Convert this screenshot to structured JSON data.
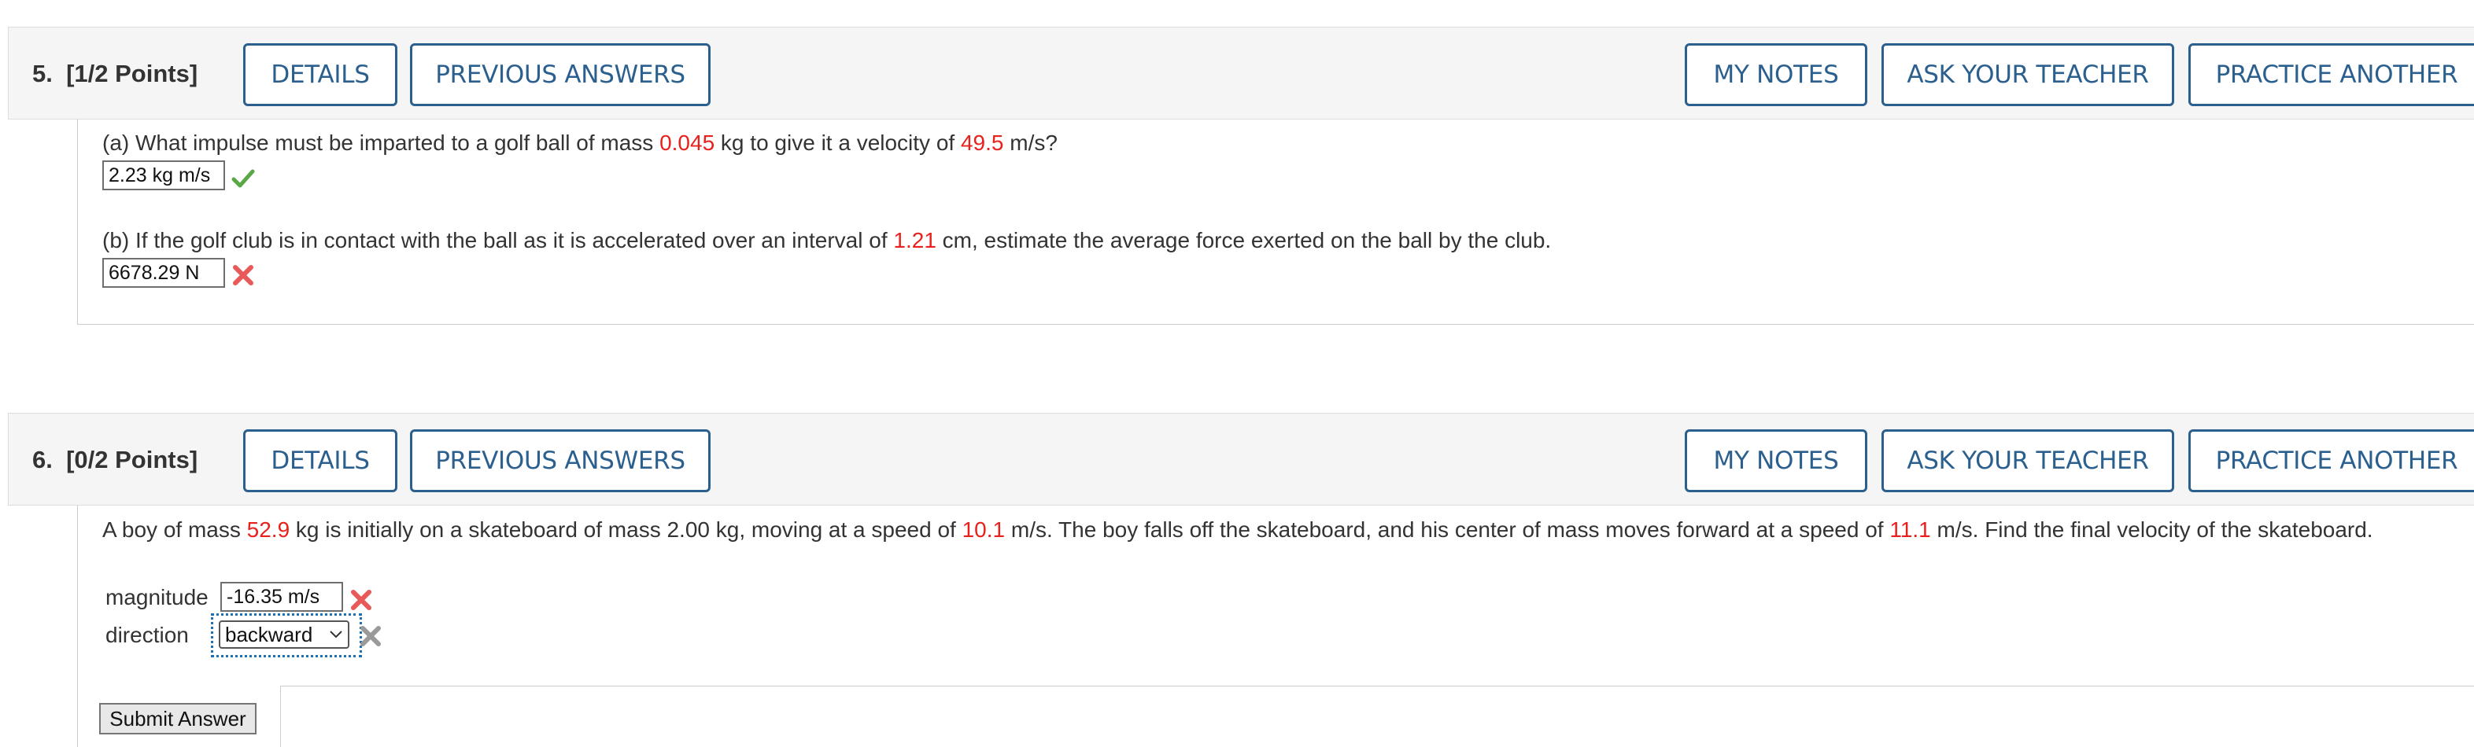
{
  "q5": {
    "number": "5.",
    "points": "[1/2 Points]",
    "buttons": {
      "details": "DETAILS",
      "previous_answers": "PREVIOUS ANSWERS",
      "my_notes": "MY NOTES",
      "ask_teacher": "ASK YOUR TEACHER",
      "practice": "PRACTICE ANOTHER"
    },
    "part_a": {
      "t1": "(a) What impulse must be imparted to a golf ball of mass ",
      "mass": "0.045",
      "t2": " kg to give it a velocity of ",
      "velocity": "49.5",
      "t3": " m/s?",
      "answer": "2.23 kg m/s",
      "status": "correct"
    },
    "part_b": {
      "t1": "(b) If the golf club is in contact with the ball as it is accelerated over an interval of ",
      "interval": "1.21",
      "t2": " cm, estimate the average force exerted on the ball by the club.",
      "answer": "6678.29 N",
      "status": "incorrect"
    }
  },
  "q6": {
    "number": "6.",
    "points": "[0/2 Points]",
    "buttons": {
      "details": "DETAILS",
      "previous_answers": "PREVIOUS ANSWERS",
      "my_notes": "MY NOTES",
      "ask_teacher": "ASK YOUR TEACHER",
      "practice": "PRACTICE ANOTHER"
    },
    "question": {
      "t1": "A boy of mass ",
      "boy_mass": "52.9",
      "t2": " kg is initially on a skateboard of mass 2.00 kg, moving at a speed of ",
      "speed1": "10.1",
      "t3": " m/s. The boy falls off the skateboard, and his center of mass moves forward at a speed of ",
      "speed2": "11.1",
      "t4": " m/s. Find the final velocity of the skateboard."
    },
    "magnitude": {
      "label": "magnitude",
      "answer": "-16.35 m/s",
      "status": "incorrect"
    },
    "direction": {
      "label": "direction",
      "selected": "backward",
      "status": "incorrect-grey"
    },
    "submit_label": "Submit Answer"
  },
  "colors": {
    "accent": "#2b5f8e",
    "highlight_red": "#e8211d",
    "correct_green": "#5aa845",
    "incorrect_red": "#e85a5a",
    "neutral_grey": "#9a9a9a",
    "focus_blue": "#1f6fb4"
  }
}
